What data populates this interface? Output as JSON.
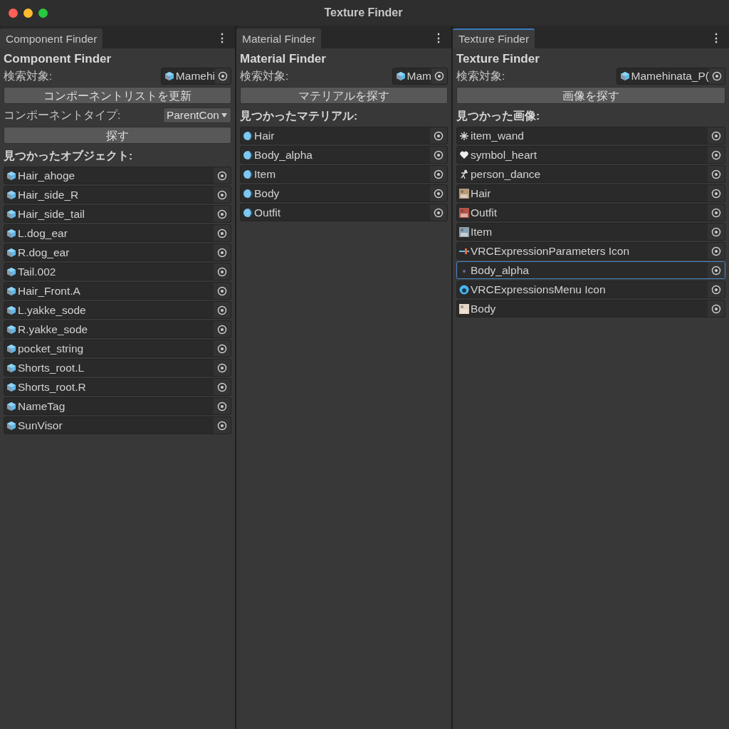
{
  "window": {
    "title": "Texture Finder"
  },
  "panels": [
    {
      "tab": {
        "label": "Component Finder",
        "selected": false
      },
      "menu": "⋮",
      "heading": "Component Finder",
      "controls": [
        {
          "kind": "object_field",
          "label": "検索対象:",
          "value": "Mamehi"
        },
        {
          "kind": "button",
          "label": "コンポーネントリストを更新"
        },
        {
          "kind": "dropdown",
          "label": "コンポーネントタイプ:",
          "value": "ParentCon"
        },
        {
          "kind": "button",
          "label": "探す"
        },
        {
          "kind": "section",
          "label": "見つかったオブジェクト:"
        }
      ],
      "results": [
        {
          "label": "Hair_ahoge",
          "kind": "cube",
          "selected": false
        },
        {
          "label": "Hair_side_R",
          "kind": "cube",
          "selected": false
        },
        {
          "label": "Hair_side_tail",
          "kind": "cube",
          "selected": false
        },
        {
          "label": "L.dog_ear",
          "kind": "cube",
          "selected": false
        },
        {
          "label": "R.dog_ear",
          "kind": "cube",
          "selected": false
        },
        {
          "label": "Tail.002",
          "kind": "cube",
          "selected": false
        },
        {
          "label": "Hair_Front.A",
          "kind": "cube",
          "selected": false
        },
        {
          "label": "L.yakke_sode",
          "kind": "cube",
          "selected": false
        },
        {
          "label": "R.yakke_sode",
          "kind": "cube",
          "selected": false
        },
        {
          "label": "pocket_string",
          "kind": "cube",
          "selected": false
        },
        {
          "label": "Shorts_root.L",
          "kind": "cube",
          "selected": false
        },
        {
          "label": "Shorts_root.R",
          "kind": "cube",
          "selected": false
        },
        {
          "label": "NameTag",
          "kind": "cube",
          "selected": false
        },
        {
          "label": "SunVisor",
          "kind": "cube",
          "selected": false
        }
      ]
    },
    {
      "tab": {
        "label": "Material Finder",
        "selected": false
      },
      "menu": "⋮",
      "heading": "Material Finder",
      "controls": [
        {
          "kind": "object_field",
          "label": "検索対象:",
          "value": "Mam"
        },
        {
          "kind": "button",
          "label": "マテリアルを探す"
        },
        {
          "kind": "section",
          "label": "見つかったマテリアル:"
        }
      ],
      "results": [
        {
          "label": "Hair",
          "kind": "sphere",
          "selected": false
        },
        {
          "label": "Body_alpha",
          "kind": "sphere",
          "selected": false
        },
        {
          "label": "Item",
          "kind": "sphere",
          "selected": false
        },
        {
          "label": "Body",
          "kind": "sphere",
          "selected": false
        },
        {
          "label": "Outfit",
          "kind": "sphere",
          "selected": false
        }
      ]
    },
    {
      "tab": {
        "label": "Texture Finder",
        "selected": true
      },
      "menu": "⋮",
      "heading": "Texture Finder",
      "controls": [
        {
          "kind": "object_field",
          "label": "検索対象:",
          "value": "Mamehinata_P("
        },
        {
          "kind": "button",
          "label": "画像を探す"
        },
        {
          "kind": "section",
          "label": "見つかった画像:"
        }
      ],
      "results": [
        {
          "label": "item_wand",
          "kind": "sparkle",
          "selected": false
        },
        {
          "label": "symbol_heart",
          "kind": "heart",
          "selected": false
        },
        {
          "label": "person_dance",
          "kind": "dancer",
          "selected": false
        },
        {
          "label": "Hair",
          "kind": "thumbnail",
          "color": "#b89a7a",
          "selected": false
        },
        {
          "label": "Outfit",
          "kind": "thumbnail",
          "color": "#b5544a",
          "selected": false
        },
        {
          "label": "Item",
          "kind": "thumbnail",
          "color": "#8aa0b0",
          "selected": false
        },
        {
          "label": "VRCExpressionParameters Icon",
          "kind": "slider",
          "selected": false
        },
        {
          "label": "Body_alpha",
          "kind": "dot",
          "selected": true
        },
        {
          "label": "VRCExpressionsMenu Icon",
          "kind": "menu-circle",
          "selected": false
        },
        {
          "label": "Body",
          "kind": "thumbnail",
          "color": "#e6d6c6",
          "selected": false
        }
      ]
    }
  ]
}
